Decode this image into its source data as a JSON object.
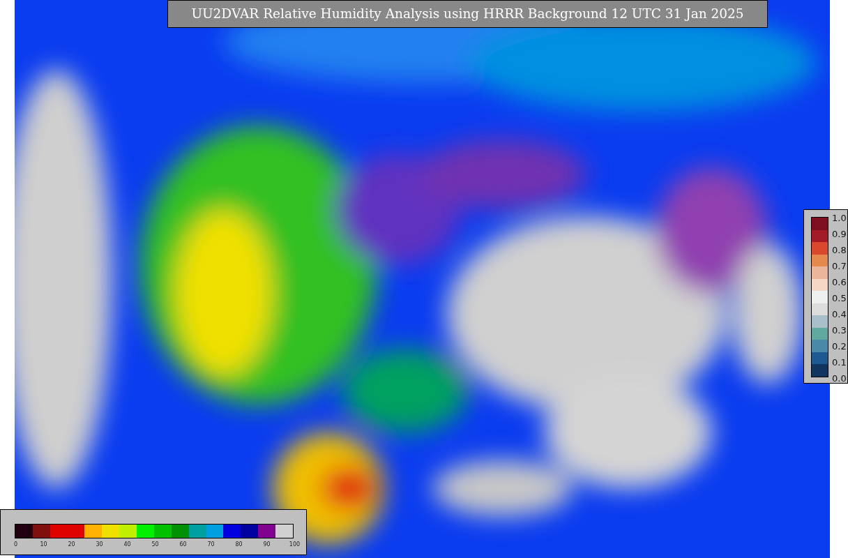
{
  "title": "UU2DVAR Relative Humidity Analysis using HRRR Background 12 UTC 31 Jan 2025",
  "station_colorbar": {
    "ticks": [
      "1.0",
      "0.9",
      "0.8",
      "0.7",
      "0.6",
      "0.5",
      "0.4",
      "0.3",
      "0.2",
      "0.1",
      "0.0"
    ]
  },
  "humidity_colorbar": {
    "ticks": [
      "0",
      "10",
      "20",
      "30",
      "40",
      "50",
      "60",
      "70",
      "80",
      "90",
      "100"
    ]
  }
}
